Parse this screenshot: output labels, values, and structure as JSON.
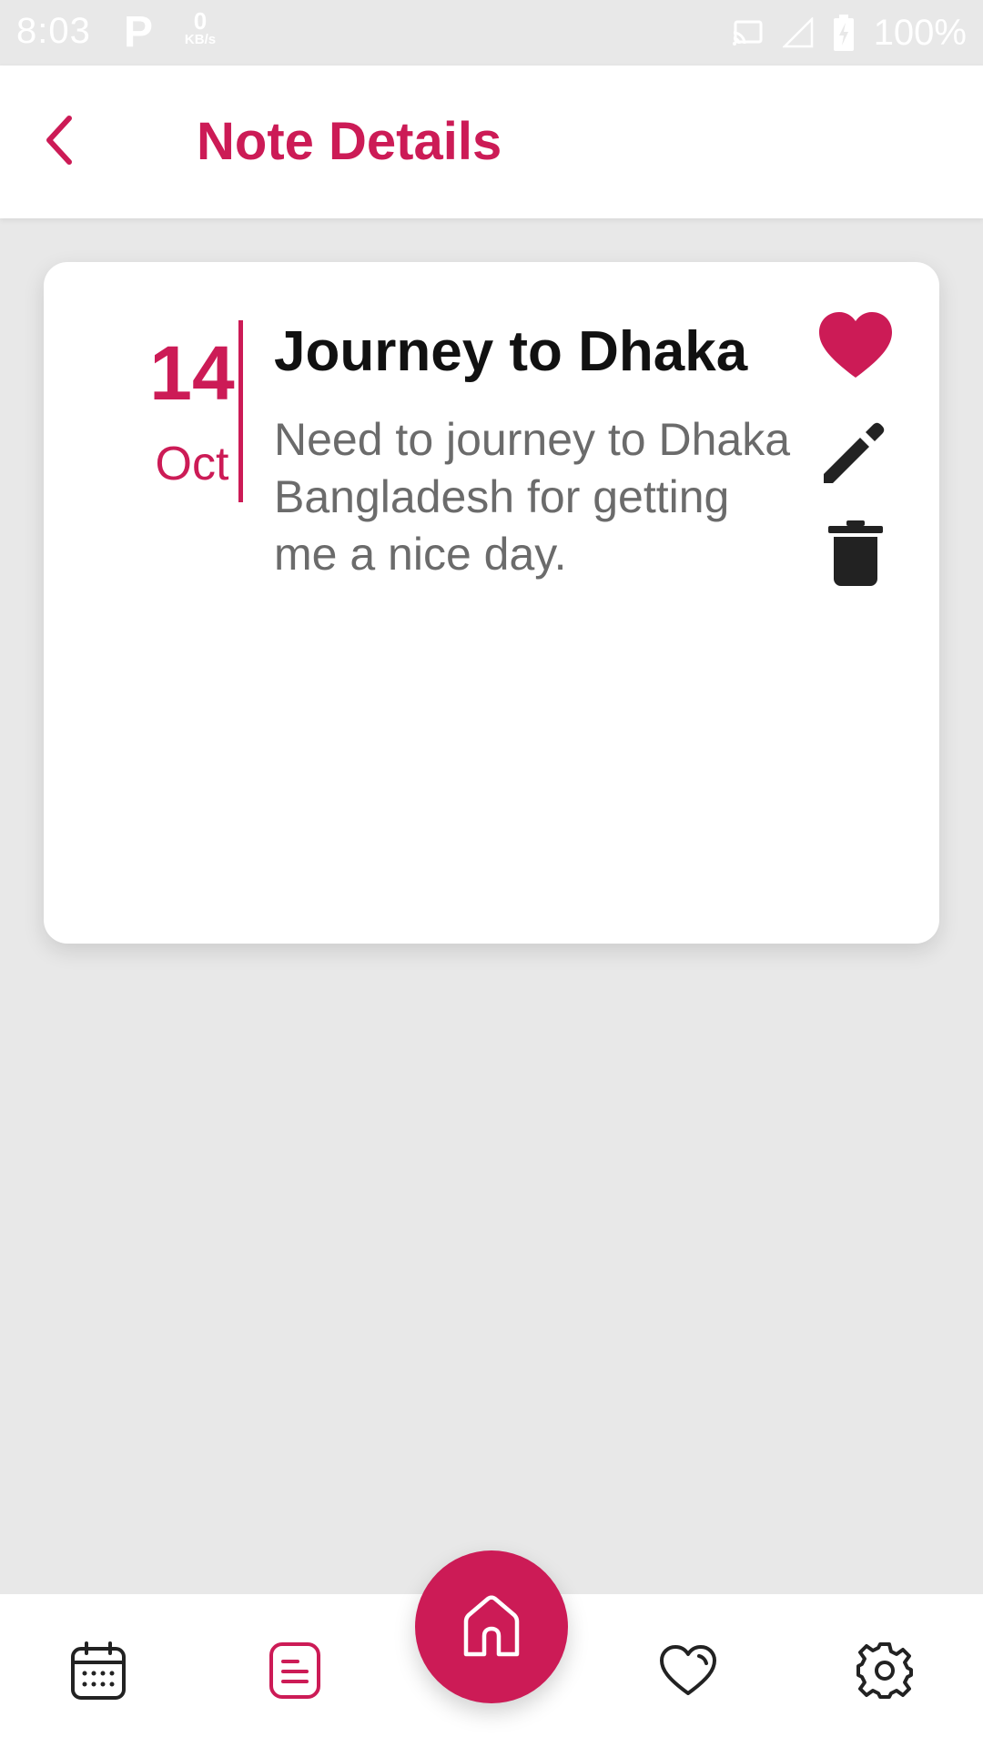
{
  "status_bar": {
    "time": "8:03",
    "p_icon": "P",
    "net_speed_value": "0",
    "net_speed_unit": "KB/s",
    "battery_percent": "100%",
    "icons": [
      "cast-icon",
      "signal-icon",
      "battery-charging-icon"
    ]
  },
  "header": {
    "title": "Note Details",
    "back_icon": "chevron-left-icon"
  },
  "note": {
    "day": "14",
    "month": "Oct",
    "title": "Journey to Dhaka",
    "body": "Need to journey to Dhaka Bangladesh for getting me a nice day.",
    "favorite": true,
    "actions": [
      "heart-icon",
      "pencil-icon",
      "trash-icon"
    ]
  },
  "bottom_nav": {
    "items": [
      "calendar-icon",
      "notes-icon",
      "home-icon",
      "heart-outline-icon",
      "gear-icon"
    ],
    "active": "notes-icon"
  },
  "colors": {
    "accent": "#cc1b56",
    "background": "#e8e8e8",
    "card": "#ffffff",
    "title_text": "#111111",
    "body_text": "#6b6b6b",
    "icon_dark": "#222222"
  }
}
